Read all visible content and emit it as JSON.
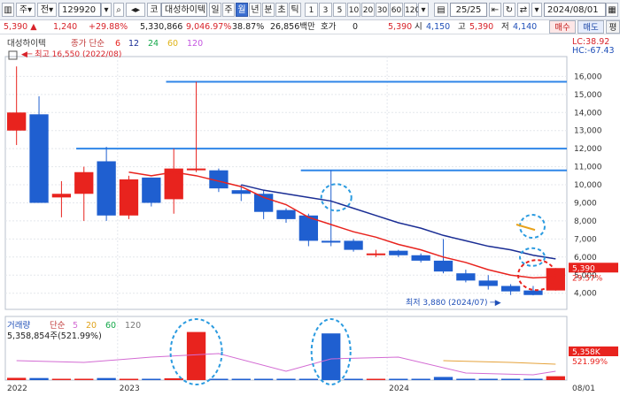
{
  "toolbar": {
    "type_label": "주",
    "period_label": "전",
    "code": "129920",
    "corp_badge": "코",
    "name": "대성하이텍",
    "periods": [
      "일",
      "주",
      "월",
      "년",
      "분",
      "초",
      "틱"
    ],
    "active_period": "월",
    "intervals": [
      "1",
      "3",
      "5",
      "10",
      "20",
      "30",
      "60",
      "120"
    ],
    "page_counter": "25/25",
    "date": "2024/08/01"
  },
  "info": {
    "price": "5,390",
    "change": "1,240",
    "change_pct": "+29.88%",
    "volume": "5,330,866",
    "vol_change_pct": "9,046.97%",
    "ratio": "38.87%",
    "amount": "26,856백만",
    "quote_label": "호가",
    "quote_value": "0",
    "quote_price": "5,390",
    "open_label": "시",
    "open": "4,150",
    "high_label": "고",
    "high": "5,390",
    "low_label": "저",
    "low": "4,140",
    "buy_label": "매수",
    "sell_label": "매도",
    "eval_label": "평"
  },
  "price_panel": {
    "legend_name": "대성하이텍",
    "legend_ma": "종가 단순",
    "ma_periods": [
      "6",
      "12",
      "24",
      "60",
      "120"
    ],
    "lc": "LC:38.92",
    "hc": "HC:-67.43",
    "max_label": "최고 16,550 (2022/08)",
    "min_label": "최저 3,880 (2024/07)",
    "current_price_tag": "5,390",
    "current_pct_tag": "29.57%"
  },
  "volume_panel": {
    "legend_name": "거래량",
    "legend_ma": "단순",
    "ma_periods": [
      "5",
      "20",
      "60",
      "120"
    ],
    "value_label": "5,358,854주(521.99%)",
    "current_tag": "5,358K",
    "pct_tag": "521.99%"
  },
  "colors": {
    "up": "#e8231e",
    "down": "#1f5fd0",
    "ma6": "#e8231e",
    "ma12": "#1a2d94",
    "hline": "#2f86e8",
    "annot": "#2b9be0"
  },
  "chart_data": {
    "type": "candlestick",
    "timeframe": "monthly",
    "y_ticks": [
      4000,
      5000,
      6000,
      7000,
      8000,
      9000,
      10000,
      11000,
      12000,
      13000,
      14000,
      15000,
      16000
    ],
    "ylim": [
      3300,
      16900
    ],
    "x_labels": [
      "2022",
      "2023",
      "2024",
      "08/01"
    ],
    "candles": [
      {
        "o": 13000,
        "h": 16550,
        "l": 12200,
        "c": 14000
      },
      {
        "o": 13900,
        "h": 14900,
        "l": 9000,
        "c": 9000
      },
      {
        "o": 9300,
        "h": 10200,
        "l": 8200,
        "c": 9500
      },
      {
        "o": 9500,
        "h": 11000,
        "l": 8000,
        "c": 10700
      },
      {
        "o": 11300,
        "h": 12100,
        "l": 8000,
        "c": 8300
      },
      {
        "o": 8300,
        "h": 10500,
        "l": 8100,
        "c": 10300
      },
      {
        "o": 10400,
        "h": 10400,
        "l": 8800,
        "c": 9000
      },
      {
        "o": 9200,
        "h": 12000,
        "l": 8400,
        "c": 10900
      },
      {
        "o": 10900,
        "h": 15700,
        "l": 10700,
        "c": 10900
      },
      {
        "o": 10800,
        "h": 10900,
        "l": 9600,
        "c": 9800
      },
      {
        "o": 9700,
        "h": 10000,
        "l": 9100,
        "c": 9500
      },
      {
        "o": 9500,
        "h": 9700,
        "l": 8100,
        "c": 8500
      },
      {
        "o": 8600,
        "h": 8700,
        "l": 7900,
        "c": 8100
      },
      {
        "o": 8300,
        "h": 8400,
        "l": 6600,
        "c": 6900
      },
      {
        "o": 6900,
        "h": 10800,
        "l": 6600,
        "c": 6800
      },
      {
        "o": 6900,
        "h": 7000,
        "l": 6300,
        "c": 6400
      },
      {
        "o": 6200,
        "h": 6400,
        "l": 6000,
        "c": 6200
      },
      {
        "o": 6350,
        "h": 6400,
        "l": 6000,
        "c": 6100
      },
      {
        "o": 6100,
        "h": 6200,
        "l": 5700,
        "c": 5800
      },
      {
        "o": 5800,
        "h": 7000,
        "l": 5100,
        "c": 5200
      },
      {
        "o": 5100,
        "h": 5300,
        "l": 4600,
        "c": 4700
      },
      {
        "o": 4700,
        "h": 5000,
        "l": 4200,
        "c": 4400
      },
      {
        "o": 4400,
        "h": 4500,
        "l": 3900,
        "c": 4100
      },
      {
        "o": 4150,
        "h": 4400,
        "l": 3880,
        "c": 3900
      },
      {
        "o": 4150,
        "h": 5390,
        "l": 4140,
        "c": 5390
      }
    ],
    "candle_index_tweaks": "24 candles shown; last candle is current month",
    "ma6": [
      null,
      null,
      null,
      null,
      null,
      null,
      10700,
      10500,
      10700,
      10500,
      10200,
      9900,
      9300,
      8900,
      8200,
      7800,
      7400,
      7100,
      6700,
      6400,
      6000,
      5700,
      5300,
      5000,
      4850,
      4900
    ],
    "ma12": [
      null,
      null,
      null,
      null,
      null,
      null,
      null,
      null,
      null,
      null,
      null,
      10000,
      9700,
      9500,
      9300,
      9100,
      8700,
      8300,
      7900,
      7600,
      7200,
      6900,
      6600,
      6400,
      6100,
      5900
    ],
    "hlines": [
      15700,
      12000,
      10800
    ],
    "volume": [
      250000,
      230000,
      140000,
      150000,
      230000,
      130000,
      120000,
      200000,
      5358854,
      100000,
      90000,
      80000,
      60000,
      40000,
      5200000,
      60000,
      50000,
      80000,
      40000,
      350000,
      90000,
      70000,
      80000,
      60000,
      430000
    ],
    "volume_ylim": [
      0,
      6500000
    ],
    "volume_ticks": [
      10000,
      20000,
      30000,
      40000,
      50000
    ]
  }
}
